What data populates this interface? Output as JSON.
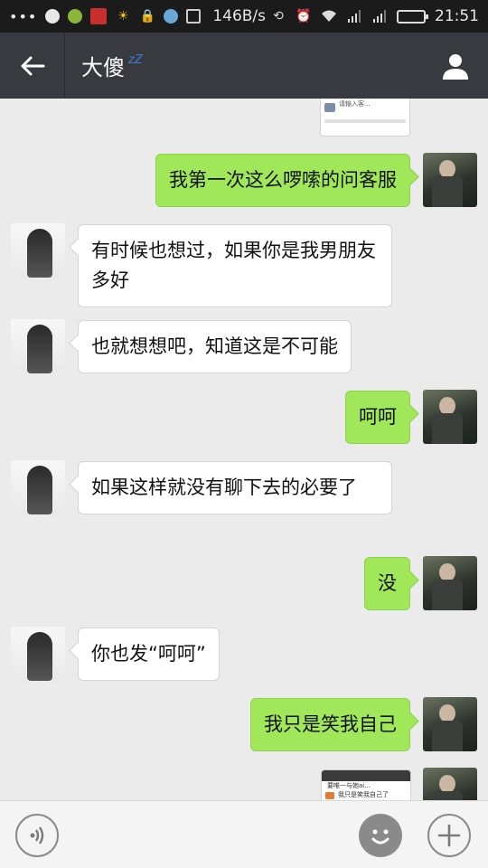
{
  "status_bar": {
    "left_glyph": "•••",
    "net_speed": "146B/s",
    "time": "21:51",
    "battery_level": 0.9,
    "icons": [
      "notification-dots-icon",
      "android-icon",
      "app-icon-green",
      "app-icon-red",
      "sun-icon",
      "lock-icon",
      "safari-like-icon",
      "screen-capture-icon",
      "rotate-icon",
      "alarm-icon",
      "wifi-icon",
      "signal-icon",
      "signal-r-icon",
      "battery-icon"
    ]
  },
  "header": {
    "title": "大傻",
    "status_glyph": "zZ",
    "back_icon": "arrow-left-icon",
    "profile_icon": "person-icon"
  },
  "messages": [
    {
      "side": "right",
      "type": "image",
      "tiny_text": "请输入客..."
    },
    {
      "side": "right",
      "type": "text",
      "text": "我第一次这么啰嗦的问客服"
    },
    {
      "side": "left",
      "type": "text",
      "text": "有时候也想过，如果你是我男朋友多好"
    },
    {
      "side": "left",
      "type": "text",
      "text": "也就想想吧，知道这是不可能"
    },
    {
      "side": "right",
      "type": "text",
      "text": "呵呵"
    },
    {
      "side": "left",
      "type": "text",
      "text": "如果这样就没有聊下去的必要了"
    },
    {
      "side": "right",
      "type": "text",
      "text": "没"
    },
    {
      "side": "left",
      "type": "text",
      "text": "你也发“呵呵”"
    },
    {
      "side": "right",
      "type": "text",
      "text": "我只是笑我自己"
    },
    {
      "side": "right",
      "type": "image",
      "tiny_text": "要唯一与她ai...",
      "tiny_text2": "我只是笑我自己了"
    }
  ],
  "input_bar": {
    "voice_icon": "voice-icon",
    "emoji_icon": "emoji-icon",
    "plus_icon": "plus-icon"
  },
  "colors": {
    "title_bar": "#393a3f",
    "out_bubble": "#a0e75a",
    "in_bubble": "#ffffff",
    "chat_bg": "#ebebeb"
  }
}
